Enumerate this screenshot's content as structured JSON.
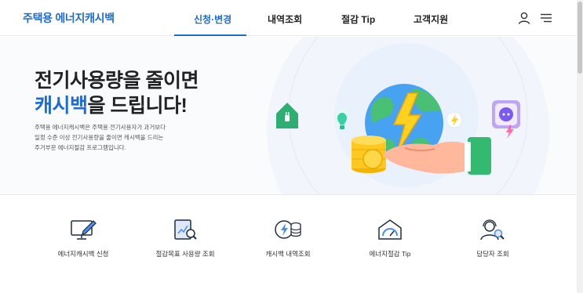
{
  "header": {
    "logo": "주택용 에너지캐시백",
    "nav": [
      {
        "label": "신청·변경",
        "active": true
      },
      {
        "label": "내역조회",
        "active": false
      },
      {
        "label": "절감 Tip",
        "active": false
      },
      {
        "label": "고객지원",
        "active": false
      }
    ],
    "icons": [
      "user-icon",
      "menu-icon"
    ]
  },
  "hero": {
    "title_line1": "전기사용량을 줄이면",
    "title_line2_accent": "캐시백",
    "title_line2_rest": "을 드립니다!",
    "description": [
      "주택용 에너지캐시백은 주택용 전기사용자가 과거보다",
      "일정 수준 이상 전기사용량을 줄이면 캐시백을 드리는",
      "주거부문 에너지절감 프로그램입니다."
    ]
  },
  "services": [
    {
      "label": "에너지캐시백 신청",
      "icon": "monitor-pen-icon"
    },
    {
      "label": "절감목표 사용량 조회",
      "icon": "chart-search-icon"
    },
    {
      "label": "캐시백 내역조회",
      "icon": "lightning-coins-icon"
    },
    {
      "label": "에너지절감 Tip",
      "icon": "house-gauge-icon"
    },
    {
      "label": "담당자 조회",
      "icon": "agent-search-icon"
    }
  ],
  "colors": {
    "accent": "#1d6bd6",
    "green": "#2fae74"
  }
}
